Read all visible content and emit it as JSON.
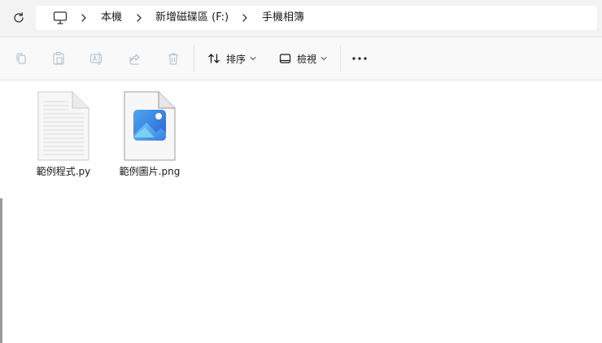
{
  "breadcrumb": {
    "root_icon": "computer-icon",
    "items": [
      "本機",
      "新增磁碟區 (F:)",
      "手機相簿"
    ]
  },
  "toolbar": {
    "actions": [
      "copy-icon",
      "paste-icon",
      "rename-icon",
      "share-icon",
      "delete-icon"
    ],
    "sort_label": "排序",
    "view_label": "檢視",
    "more_icon": "more-icon"
  },
  "files": [
    {
      "name": "範例程式.py",
      "icon": "text-file-icon"
    },
    {
      "name": "範例圖片.png",
      "icon": "image-file-icon"
    }
  ],
  "colors": {
    "addressbar_bg": "#f3f3f3",
    "toolbar_bg": "#f9f9f9",
    "disabled_icon": "#b9c6d6",
    "image_accent": "#2f7fe0"
  }
}
